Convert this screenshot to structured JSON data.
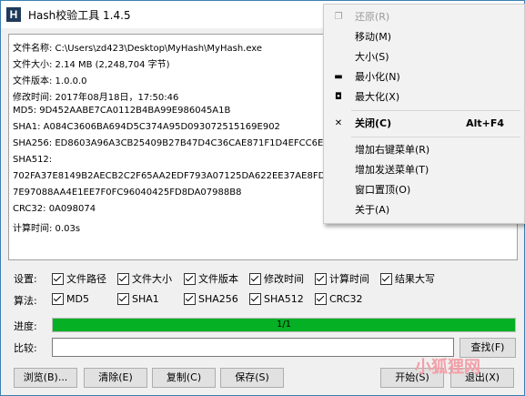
{
  "window": {
    "title": "Hash校验工具 1.4.5",
    "icon_letter": "H"
  },
  "output_lines": [
    "文件名称: C:\\Users\\zd423\\Desktop\\MyHash\\MyHash.exe",
    "文件大小: 2.14 MB (2,248,704 字节)",
    "文件版本: 1.0.0.0",
    "修改时间: 2017年08月18日，17:50:46",
    "MD5: 9D452AABE7CA0112B4BA99E986045A1B",
    "SHA1: A084C3606BA694D5C374A95D093072515169E902",
    "SHA256: ED8603A96A3CB25409B27B47D4C36CAE871F1D4EFCC6E3C0",
    "SHA512:",
    "702FA37E8149B2AECB2C2F65AA2EDF793A07125DA622EE37AE8FD39",
    "7E97088AA4E1EE7F0FC96040425FD8DA07988B8",
    "CRC32: 0A098074",
    "计算时间: 0.03s"
  ],
  "settings": {
    "label": "设置:",
    "options": [
      "文件路径",
      "文件大小",
      "文件版本",
      "修改时间",
      "计算时间",
      "结果大写"
    ]
  },
  "algorithms": {
    "label": "算法:",
    "options": [
      "MD5",
      "SHA1",
      "SHA256",
      "SHA512",
      "CRC32"
    ]
  },
  "progress": {
    "label": "进度:",
    "text": "1/1",
    "value": 1.0
  },
  "compare": {
    "label": "比较:",
    "value": "",
    "find_button": "查找(F)"
  },
  "buttons": {
    "browse": "浏览(B)...",
    "clear": "清除(E)",
    "copy": "复制(C)",
    "save": "保存(S)",
    "start": "开始(S)",
    "exit": "退出(X)"
  },
  "context_menu": {
    "restore": "还原(R)",
    "move": "移动(M)",
    "size": "大小(S)",
    "minimize": "最小化(N)",
    "maximize": "最大化(X)",
    "close": "关闭(C)",
    "close_shortcut": "Alt+F4",
    "add_right_click": "增加右键菜单(R)",
    "add_send_to": "增加发送菜单(T)",
    "topmost": "窗口置顶(O)",
    "about": "关于(A)"
  },
  "watermark": "小狐狸网"
}
